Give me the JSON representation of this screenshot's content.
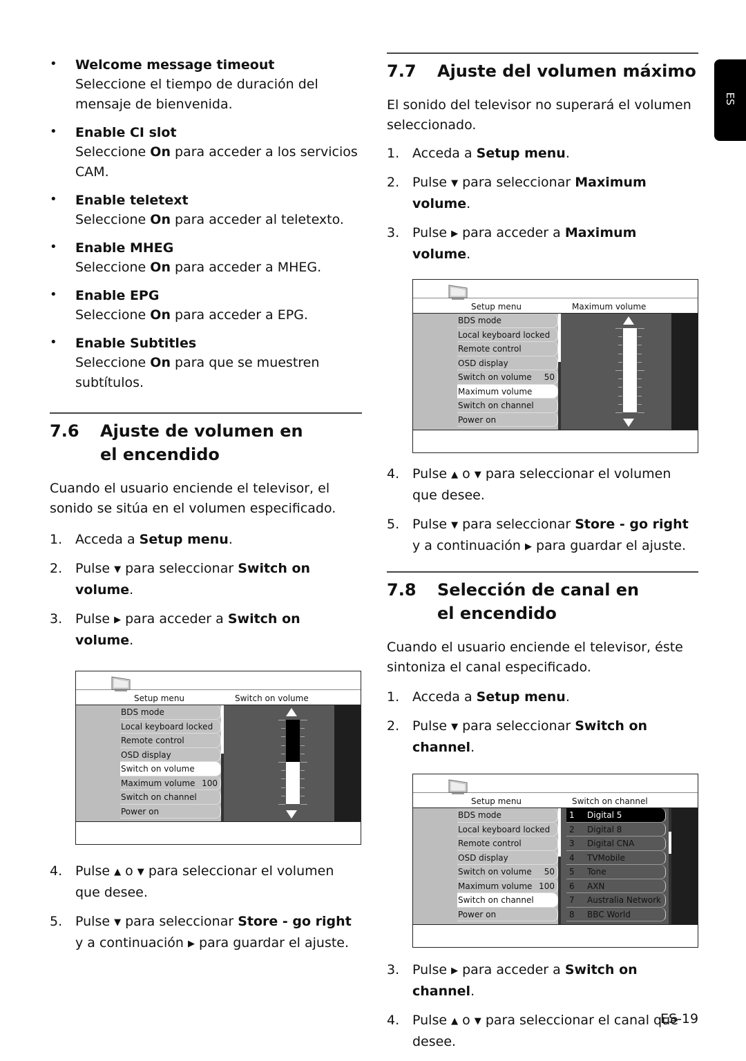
{
  "lang_tab": "ES",
  "page_number": "ES-19",
  "left_bullets": [
    {
      "title": "Welcome message timeout",
      "desc_parts": [
        "Seleccione el tiempo de duración del mensaje de bienvenida."
      ]
    },
    {
      "title": "Enable CI slot",
      "desc_pre": "Seleccione ",
      "desc_bold": "On",
      "desc_post": " para acceder a los servicios CAM."
    },
    {
      "title": "Enable teletext",
      "desc_pre": "Seleccione ",
      "desc_bold": "On",
      "desc_post": " para acceder al teletexto."
    },
    {
      "title": "Enable MHEG",
      "desc_pre": "Seleccione ",
      "desc_bold": "On",
      "desc_post": " para acceder a MHEG."
    },
    {
      "title": "Enable EPG",
      "desc_pre": "Seleccione ",
      "desc_bold": "On",
      "desc_post": " para acceder a EPG."
    },
    {
      "title": "Enable Subtitles",
      "desc_pre": "Seleccione ",
      "desc_bold": "On",
      "desc_post": " para que se muestren subtítulos."
    }
  ],
  "section_76": {
    "number": "7.6",
    "title": "Ajuste de volumen en el encendido",
    "intro": "Cuando el usuario enciende el televisor, el sonido se sitúa en el volumen especificado.",
    "steps": [
      {
        "n": "1.",
        "pre": "Acceda a ",
        "bold": "Setup menu",
        "post": "."
      },
      {
        "n": "2.",
        "pre": "Pulse ",
        "icon": "▼",
        "mid": " para seleccionar ",
        "bold": "Switch on volume",
        "post": "."
      },
      {
        "n": "3.",
        "pre": "Pulse ",
        "icon": "▶",
        "mid": " para acceder a ",
        "bold": "Switch on volume",
        "post": "."
      }
    ],
    "steps_after": [
      {
        "n": "4.",
        "pre": "Pulse ",
        "icon": "▲",
        "mid1": " o ",
        "icon2": "▼",
        "mid": " para seleccionar el volumen que desee.",
        "bold": "",
        "post": ""
      },
      {
        "n": "5.",
        "pre": "Pulse ",
        "icon": "▼",
        "mid": " para seleccionar ",
        "bold": "Store - go right",
        "post": " y a continuación ",
        "icon3": "▶",
        "post2": " para guardar el ajuste."
      }
    ],
    "osd": {
      "header_left": "Setup menu",
      "header_right": "Switch on volume",
      "menu": [
        {
          "label": "BDS mode",
          "value": ""
        },
        {
          "label": "Local keyboard locked",
          "value": ""
        },
        {
          "label": "Remote control",
          "value": ""
        },
        {
          "label": "OSD display",
          "value": ""
        },
        {
          "label": "Switch on volume",
          "value": "",
          "selected": true
        },
        {
          "label": "Maximum volume",
          "value": "100"
        },
        {
          "label": "Switch on channel",
          "value": ""
        },
        {
          "label": "Power on",
          "value": ""
        }
      ],
      "slider_value": "50",
      "slider_fraction": 0.5
    }
  },
  "section_77": {
    "number": "7.7",
    "title": "Ajuste del volumen máximo",
    "intro": "El sonido del televisor no superará el volumen seleccionado.",
    "steps": [
      {
        "n": "1.",
        "pre": "Acceda a ",
        "bold": "Setup menu",
        "post": "."
      },
      {
        "n": "2.",
        "pre": "Pulse ",
        "icon": "▼",
        "mid": " para seleccionar ",
        "bold": "Maximum volume",
        "post": "."
      },
      {
        "n": "3.",
        "pre": "Pulse ",
        "icon": "▶",
        "mid": " para acceder a ",
        "bold": "Maximum volume",
        "post": "."
      }
    ],
    "steps_after": [
      {
        "n": "4.",
        "pre": "Pulse ",
        "icon": "▲",
        "mid1": " o ",
        "icon2": "▼",
        "mid": " para seleccionar el volumen que desee."
      },
      {
        "n": "5.",
        "pre": "Pulse ",
        "icon": "▼",
        "mid": " para seleccionar ",
        "bold": "Store - go right",
        "post": " y a continuación ",
        "icon3": "▶",
        "post2": " para guardar el ajuste."
      }
    ],
    "osd": {
      "header_left": "Setup menu",
      "header_right": "Maximum volume",
      "menu": [
        {
          "label": "BDS mode",
          "value": ""
        },
        {
          "label": "Local keyboard locked",
          "value": ""
        },
        {
          "label": "Remote control",
          "value": ""
        },
        {
          "label": "OSD display",
          "value": ""
        },
        {
          "label": "Switch on volume",
          "value": "50"
        },
        {
          "label": "Maximum volume",
          "value": "",
          "selected": true
        },
        {
          "label": "Switch on channel",
          "value": ""
        },
        {
          "label": "Power on",
          "value": ""
        }
      ],
      "slider_value": "100",
      "slider_fraction": 1.0
    }
  },
  "section_78": {
    "number": "7.8",
    "title": "Selección de canal en el encendido",
    "intro": "Cuando el usuario enciende el televisor, éste sintoniza el canal especificado.",
    "steps": [
      {
        "n": "1.",
        "pre": "Acceda a ",
        "bold": "Setup menu",
        "post": "."
      },
      {
        "n": "2.",
        "pre": "Pulse ",
        "icon": "▼",
        "mid": " para seleccionar ",
        "bold": "Switch on channel",
        "post": "."
      }
    ],
    "steps_after": [
      {
        "n": "3.",
        "pre": "Pulse ",
        "icon": "▶",
        "mid": " para acceder a ",
        "bold": "Switch on channel",
        "post": "."
      },
      {
        "n": "4.",
        "pre": "Pulse ",
        "icon": "▲",
        "mid1": " o ",
        "icon2": "▼",
        "mid": " para seleccionar el canal que desee."
      }
    ],
    "osd": {
      "header_left": "Setup menu",
      "header_right": "Switch on channel",
      "menu": [
        {
          "label": "BDS mode",
          "value": ""
        },
        {
          "label": "Local keyboard locked",
          "value": ""
        },
        {
          "label": "Remote control",
          "value": ""
        },
        {
          "label": "OSD display",
          "value": ""
        },
        {
          "label": "Switch on volume",
          "value": "50"
        },
        {
          "label": "Maximum volume",
          "value": "100"
        },
        {
          "label": "Switch on channel",
          "value": "",
          "selected": true
        },
        {
          "label": "Power on",
          "value": ""
        }
      ],
      "channels": [
        {
          "num": "1",
          "name": "Digital 5",
          "selected": true
        },
        {
          "num": "2",
          "name": "Digital 8"
        },
        {
          "num": "3",
          "name": "Digital CNA"
        },
        {
          "num": "4",
          "name": "TVMobile"
        },
        {
          "num": "5",
          "name": "Tone"
        },
        {
          "num": "6",
          "name": "AXN"
        },
        {
          "num": "7",
          "name": "Australia Network"
        },
        {
          "num": "8",
          "name": "BBC World"
        }
      ]
    }
  }
}
